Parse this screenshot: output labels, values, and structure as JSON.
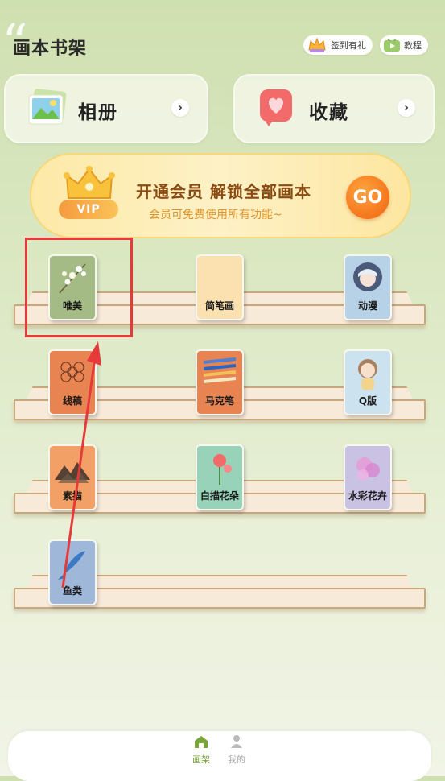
{
  "header": {
    "title": "画本书架",
    "checkin_label": "签到有礼",
    "tutorial_label": "教程"
  },
  "top_cards": [
    {
      "label": "相册",
      "icon": "photo-album-icon"
    },
    {
      "label": "收藏",
      "icon": "heart-favorite-icon"
    }
  ],
  "vip_banner": {
    "badge": "VIP",
    "title": "开通会员 解锁全部画本",
    "subtitle": "会员可免费使用所有功能~",
    "button": "GO"
  },
  "books": [
    {
      "label": "唯美",
      "color": "#a4bb86"
    },
    {
      "label": "简笔画",
      "color": "#fbe0b0"
    },
    {
      "label": "动漫",
      "color": "#b7d2e6"
    },
    {
      "label": "线稿",
      "color": "#e88452"
    },
    {
      "label": "马克笔",
      "color": "#e88452"
    },
    {
      "label": "Q版",
      "color": "#cde2ef"
    },
    {
      "label": "素描",
      "color": "#f3a067"
    },
    {
      "label": "白描花朵",
      "color": "#98d2b9"
    },
    {
      "label": "水彩花卉",
      "color": "#c9c2e3"
    },
    {
      "label": "鱼类",
      "color": "#9fb7d8"
    }
  ],
  "bottom_nav": {
    "items": [
      {
        "label": "画架",
        "active": true
      },
      {
        "label": "我的",
        "active": false
      }
    ],
    "active_color": "#7aa43a",
    "inactive_color": "#aaaaaa"
  }
}
